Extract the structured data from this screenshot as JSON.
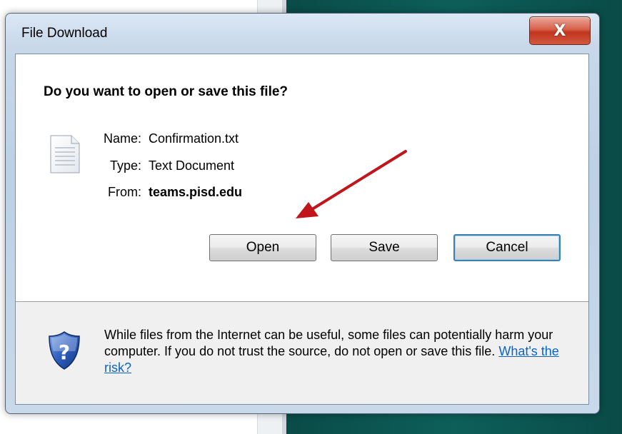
{
  "window": {
    "title": "File Download",
    "close_glyph": "X"
  },
  "dialog": {
    "question": "Do you want to open or save this file?",
    "file": {
      "icon": "text-file-icon",
      "name_label": "Name:",
      "name_value": "Confirmation.txt",
      "type_label": "Type:",
      "type_value": "Text Document",
      "from_label": "From:",
      "from_value": "teams.pisd.edu"
    },
    "buttons": {
      "open": "Open",
      "save": "Save",
      "cancel": "Cancel"
    },
    "footer": {
      "icon": "shield-question-icon",
      "warning": "While files from the Internet can be useful, some files can potentially harm your computer. If you do not trust the source, do not open or save this file.",
      "link": "What's the risk?"
    }
  },
  "annotation": {
    "arrow_color": "#c0161b"
  }
}
